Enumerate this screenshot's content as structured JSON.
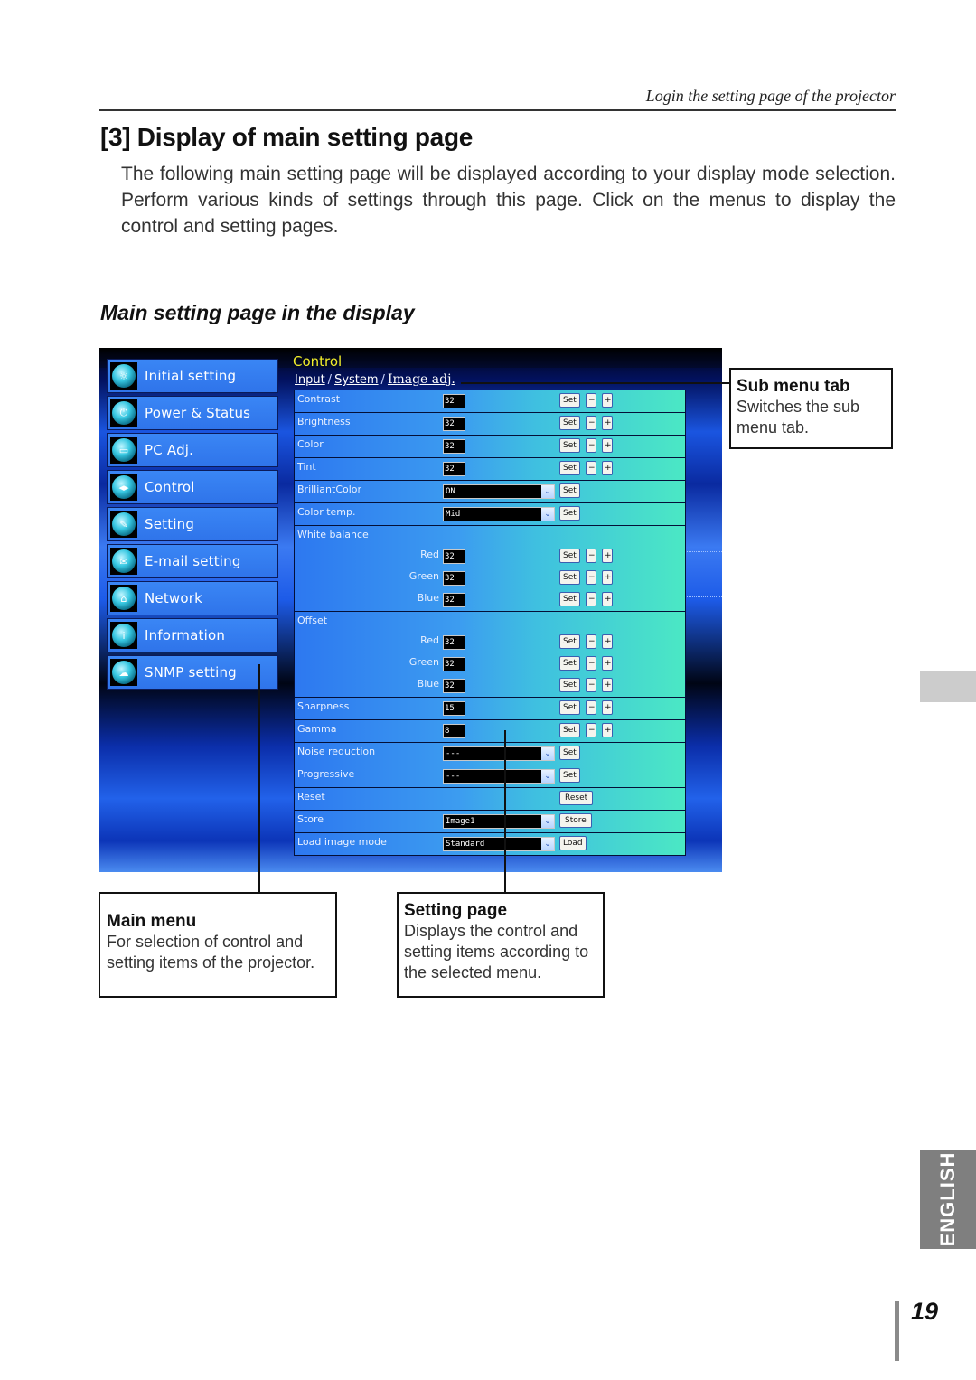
{
  "header": {
    "running_head": "Login the setting page of the projector",
    "section_title": "[3] Display of main setting page",
    "intro": "The following main setting page will be displayed according to your display mode selection. Perform various kinds of settings through this page. Click on the menus to display the control and setting pages.",
    "subsection_title": "Main setting page in the display"
  },
  "screenshot": {
    "menu": [
      {
        "label": "Initial setting",
        "icon": "initial-setting-icon"
      },
      {
        "label": "Power & Status",
        "icon": "power-status-icon"
      },
      {
        "label": "PC Adj.",
        "icon": "pc-adj-icon"
      },
      {
        "label": "Control",
        "icon": "control-icon"
      },
      {
        "label": "Setting",
        "icon": "setting-icon"
      },
      {
        "label": "E-mail setting",
        "icon": "email-icon"
      },
      {
        "label": "Network",
        "icon": "network-icon"
      },
      {
        "label": "Information",
        "icon": "information-icon"
      },
      {
        "label": "SNMP setting",
        "icon": "snmp-icon"
      }
    ],
    "page_title": "Control",
    "subtabs": [
      "Input",
      "System",
      "Image adj."
    ],
    "subtab_separator": "/",
    "buttons": {
      "set": "Set",
      "minus": "−",
      "plus": "+",
      "reset": "Reset",
      "store": "Store",
      "load": "Load"
    },
    "rows": {
      "contrast": {
        "label": "Contrast",
        "value": "32"
      },
      "brightness": {
        "label": "Brightness",
        "value": "32"
      },
      "color": {
        "label": "Color",
        "value": "32"
      },
      "tint": {
        "label": "Tint",
        "value": "32"
      },
      "brilliant_color": {
        "label": "BrilliantColor",
        "value": "ON"
      },
      "color_temp": {
        "label": "Color temp.",
        "value": "Mid"
      },
      "white_balance": {
        "label": "White balance",
        "red_label": "Red",
        "red": "32",
        "green_label": "Green",
        "green": "32",
        "blue_label": "Blue",
        "blue": "32"
      },
      "offset": {
        "label": "Offset",
        "red_label": "Red",
        "red": "32",
        "green_label": "Green",
        "green": "32",
        "blue_label": "Blue",
        "blue": "32"
      },
      "sharpness": {
        "label": "Sharpness",
        "value": "15"
      },
      "gamma": {
        "label": "Gamma",
        "value": "8"
      },
      "noise_reduction": {
        "label": "Noise reduction",
        "value": "---"
      },
      "progressive": {
        "label": "Progressive",
        "value": "---"
      },
      "reset": {
        "label": "Reset"
      },
      "store": {
        "label": "Store",
        "value": "Image1"
      },
      "load_image_mode": {
        "label": "Load image mode",
        "value": "Standard"
      }
    },
    "colors": {
      "menu_item": "#3a86f5",
      "title_yellow": "#f3ef2a",
      "row_left": "#2d78f0",
      "row_right": "#4be8c4"
    }
  },
  "callouts": {
    "sub_menu_tab": {
      "title": "Sub menu tab",
      "desc": "Switches the sub menu tab."
    },
    "main_menu": {
      "title": "Main menu",
      "desc": "For selection of  control and setting items of the projector."
    },
    "setting_page": {
      "title": "Setting page",
      "desc": "Displays the control and setting items according to the selected menu."
    }
  },
  "side_tab": {
    "language": "ENGLISH"
  },
  "footer": {
    "page_number": "19"
  }
}
